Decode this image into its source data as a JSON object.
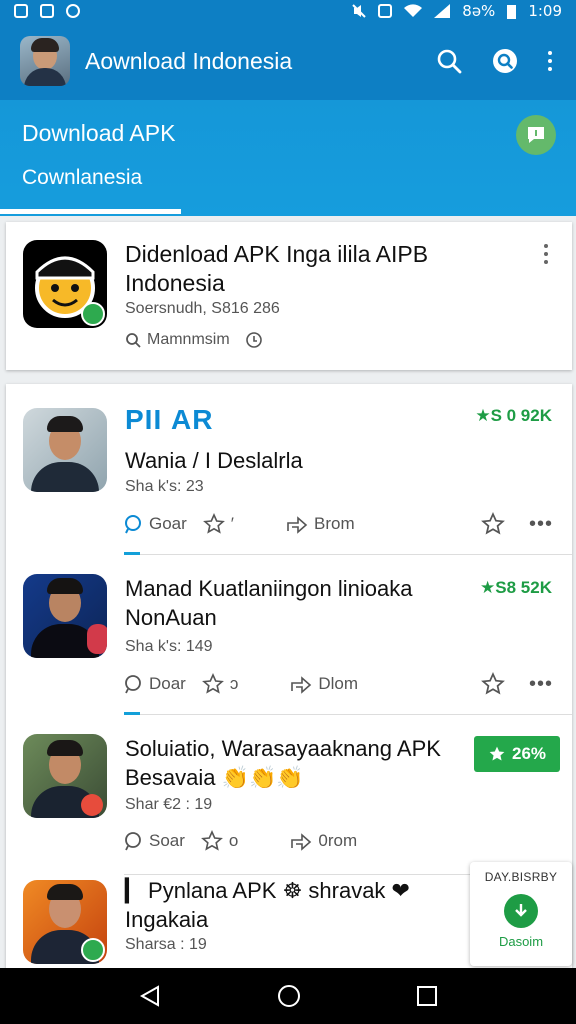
{
  "status_bar": {
    "battery_text": "8ə%",
    "time": "1:09"
  },
  "app_bar": {
    "title": "Aownload Indonesia",
    "icons": [
      "search-icon",
      "search-circle-icon",
      "more-vert-icon"
    ]
  },
  "header": {
    "title": "Download APK",
    "tab_label": "Cownlanesia",
    "badge_icon": "chat-badge-icon"
  },
  "featured": {
    "title": "Didenload APK Inga ilila AIPB Indonesia",
    "subtitle": "Soersnudh, S816 286",
    "meta": "Mamnmsim"
  },
  "items": [
    {
      "brand": "PIΙ AR",
      "title": "Wania / I Deslalrla",
      "shares": "Sha k's: 23",
      "price": "★S 0 92K",
      "action_comment": "Goar",
      "action_star": "′",
      "action_share": "Brom"
    },
    {
      "title": "Manad Kuatlaniingon linioaka NonAuan",
      "shares": "Sha k's: 149",
      "price": "★S8 52K",
      "action_comment": "Doar",
      "action_star": "ɔ",
      "action_share": "Dlom"
    },
    {
      "title": "Soluiatio, Warasayaaknang APK Besavaia 👏👏👏",
      "shares": "Shar €2 : 19",
      "rating": "26%",
      "action_comment": "Soar",
      "action_star": "o",
      "action_share": "0rom"
    },
    {
      "title": "▎ Pynlana APK ☸ shravak ❤ Ingakaia",
      "shares": "Sharsa : 19"
    }
  ],
  "float_card": {
    "title": "DAY.BISRBY",
    "label": "Dasoim"
  },
  "colors": {
    "primary": "#0d7fc4",
    "header": "#169ddd",
    "green": "#24a84b",
    "text": "#111111"
  }
}
